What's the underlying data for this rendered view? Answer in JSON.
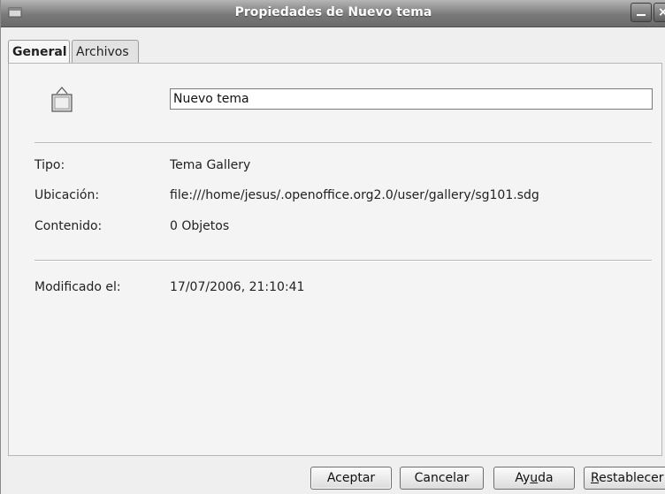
{
  "window": {
    "title": "Propiedades de Nuevo tema"
  },
  "tabs": [
    {
      "label": "General",
      "active": true
    },
    {
      "label": "Archivos",
      "active": false
    }
  ],
  "general": {
    "name_value": "Nuevo tema",
    "fields": {
      "tipo": {
        "label": "Tipo:",
        "value": "Tema Gallery"
      },
      "ubicacion": {
        "label": "Ubicación:",
        "value": "file:///home/jesus/.openoffice.org2.0/user/gallery/sg101.sdg"
      },
      "contenido": {
        "label": "Contenido:",
        "value": "0 Objetos"
      },
      "modificado": {
        "label": "Modificado el:",
        "value": "17/07/2006, 21:10:41"
      }
    }
  },
  "buttons": {
    "aceptar": "Aceptar",
    "cancelar": "Cancelar",
    "ayuda_pre": "Ay",
    "ayuda_mnemonic": "u",
    "ayuda_post": "da",
    "restablecer_mnemonic": "R",
    "restablecer_post": "establecer"
  },
  "icons": {
    "window_menu": "window-menu-icon",
    "minimize": "minimize-icon",
    "close": "close-icon",
    "theme": "gallery-theme-icon"
  },
  "colors": {
    "titlebar": "#7a7a7a",
    "background": "#efefef",
    "input_background": "#ffffff"
  }
}
